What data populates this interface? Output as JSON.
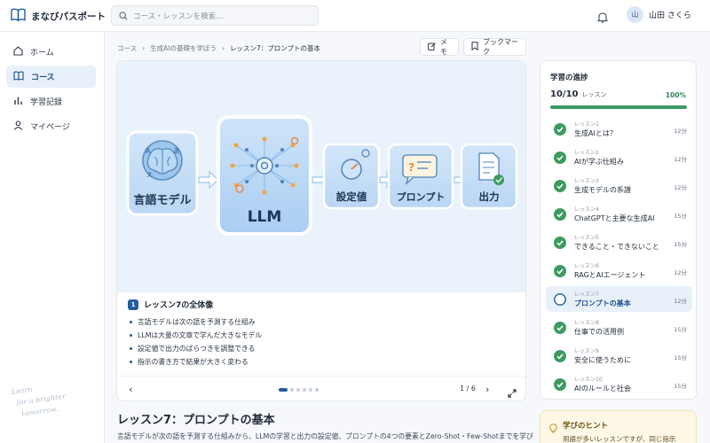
{
  "app": {
    "title": "まなびパスポート"
  },
  "search": {
    "placeholder": "コース・レッスンを検索…"
  },
  "user": {
    "avatar": "山",
    "name": "山田 さくら"
  },
  "sidebar": {
    "items": [
      {
        "label": "ホーム",
        "icon": "home-icon",
        "active": false
      },
      {
        "label": "コース",
        "icon": "book-icon",
        "active": true
      },
      {
        "label": "学習記録",
        "icon": "bar-chart-icon",
        "active": false
      },
      {
        "label": "マイページ",
        "icon": "person-icon",
        "active": false
      }
    ],
    "note": [
      "Learn",
      "for a brighter",
      "tomorrow."
    ]
  },
  "breadcrumb": [
    "コース",
    "生成AIの基礎を学ぼう",
    "レッスン7：プロンプトの基本"
  ],
  "actions": {
    "memo": "メモ",
    "bookmark": "ブックマーク"
  },
  "diagram": {
    "nodes": [
      "言語モデル",
      "LLM",
      "設定値",
      "プロンプト",
      "出力"
    ],
    "glyphs": [
      "A",
      "あ",
      "文",
      "あ"
    ]
  },
  "summary": {
    "number": "1",
    "title": "レッスン7の全体像",
    "items": [
      "言語モデルは次の語を予測する仕組み",
      "LLMは大量の文章で学んだ大きなモデル",
      "設定値で出力のばらつきを調整できる",
      "指示の書き方で結果が大きく変わる"
    ]
  },
  "pager": {
    "current": 1,
    "total": 6,
    "label": "1 / 6"
  },
  "lesson": {
    "title": "レッスン7：プロンプトの基本",
    "description": "言語モデルが次の語を予測する仕組みから、LLMの学習と出力の設定値、プロンプトの4つの要素とZero-Shot・Few-Shotまでを学び"
  },
  "progress": {
    "title": "学習の進捗",
    "count": "10/10",
    "unit": "レッスン",
    "percent_label": "100%",
    "fraction": 1.0,
    "lessons": [
      {
        "kicker": "レッスン1",
        "name": "生成AIとは？",
        "duration": "12分",
        "done": true
      },
      {
        "kicker": "レッスン2",
        "name": "AIが学ぶ仕組み",
        "duration": "12分",
        "done": true
      },
      {
        "kicker": "レッスン3",
        "name": "生成モデルの系譜",
        "duration": "12分",
        "done": true
      },
      {
        "kicker": "レッスン4",
        "name": "ChatGPTと主要な生成AI",
        "duration": "15分",
        "done": true
      },
      {
        "kicker": "レッスン5",
        "name": "できること・できないこと",
        "duration": "15分",
        "done": true
      },
      {
        "kicker": "レッスン6",
        "name": "RAGとAIエージェント",
        "duration": "12分",
        "done": true
      },
      {
        "kicker": "レッスン7",
        "name": "プロンプトの基本",
        "duration": "12分",
        "done": false,
        "active": true
      },
      {
        "kicker": "レッスン8",
        "name": "仕事での活用例",
        "duration": "15分",
        "done": true
      },
      {
        "kicker": "レッスン9",
        "name": "安全に使うために",
        "duration": "15分",
        "done": true
      },
      {
        "kicker": "レッスン10",
        "name": "AIのルールと社会",
        "duration": "15分",
        "done": true
      }
    ]
  },
  "hint": {
    "title": "学びのヒント",
    "text": "用語が多いレッスンですが、同じ指示"
  },
  "colors": {
    "accent": "#245c9e",
    "success": "#3c9b62",
    "background": "#f6f8fb"
  }
}
